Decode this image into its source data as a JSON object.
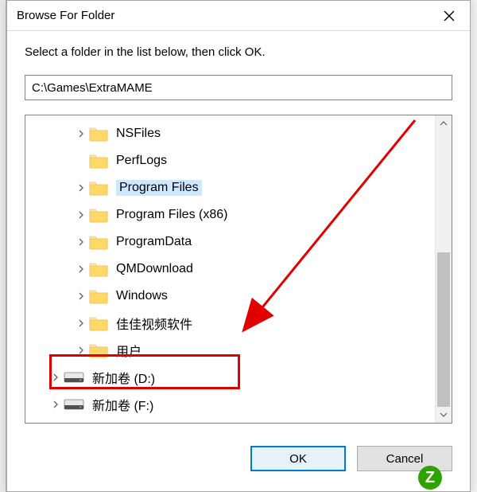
{
  "dialog": {
    "title": "Browse For Folder",
    "instruction": "Select a folder in the list below, then click OK.",
    "path_value": "C:\\Games\\ExtraMAME"
  },
  "tree": {
    "items": [
      {
        "label": "NSFiles",
        "icon": "folder",
        "level": 1,
        "expandable": true,
        "selected": false
      },
      {
        "label": "PerfLogs",
        "icon": "folder",
        "level": 1,
        "expandable": false,
        "selected": false
      },
      {
        "label": "Program Files",
        "icon": "folder",
        "level": 1,
        "expandable": true,
        "selected": true
      },
      {
        "label": "Program Files (x86)",
        "icon": "folder",
        "level": 1,
        "expandable": true,
        "selected": false
      },
      {
        "label": "ProgramData",
        "icon": "folder",
        "level": 1,
        "expandable": true,
        "selected": false
      },
      {
        "label": "QMDownload",
        "icon": "folder",
        "level": 1,
        "expandable": true,
        "selected": false
      },
      {
        "label": "Windows",
        "icon": "folder",
        "level": 1,
        "expandable": true,
        "selected": false
      },
      {
        "label": "佳佳视频软件",
        "icon": "folder",
        "level": 1,
        "expandable": true,
        "selected": false
      },
      {
        "label": "用户",
        "icon": "folder",
        "level": 1,
        "expandable": true,
        "selected": false
      },
      {
        "label": "新加卷 (D:)",
        "icon": "drive",
        "level": 0,
        "expandable": true,
        "selected": false
      },
      {
        "label": "新加卷 (F:)",
        "icon": "drive",
        "level": 0,
        "expandable": true,
        "selected": false
      }
    ]
  },
  "buttons": {
    "ok": "OK",
    "cancel": "Cancel"
  },
  "annotation": {
    "highlight_box": {
      "target_index": 9
    },
    "arrow": {
      "from_corner": "top-right",
      "to_target_index": 7
    }
  },
  "watermark": {
    "logo_letter": "Z",
    "text": ""
  }
}
